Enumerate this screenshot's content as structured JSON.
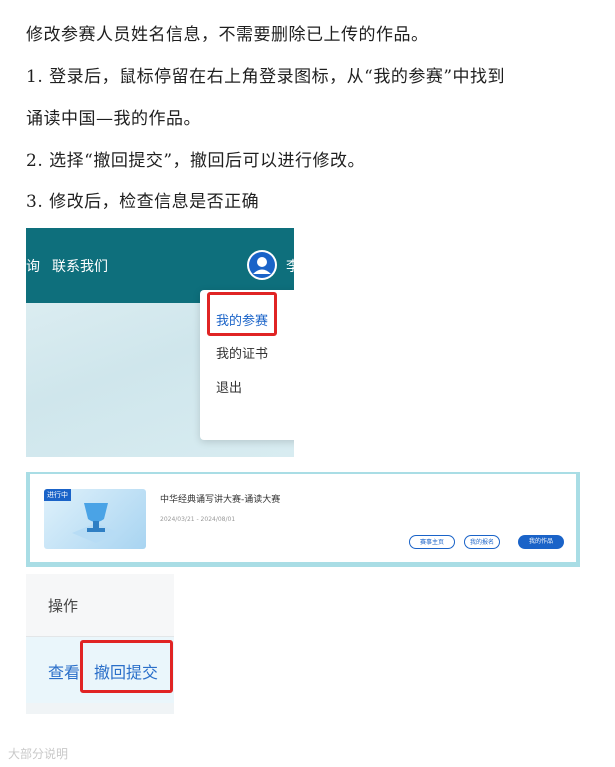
{
  "instructions": {
    "intro": "修改参赛人员姓名信息，不需要删除已上传的作品。",
    "step1_a": "1. 登录后，鼠标停留在右上角登录图标，从“我的参赛”中找到",
    "step1_b": "诵读中国—我的作品。",
    "step2": "2. 选择“撤回提交”，撤回后可以进行修改。",
    "step3": "3. 修改后，检查信息是否正确"
  },
  "screenshot1": {
    "nav_partial": "询",
    "nav_contact": "联系我们",
    "user_partial": "李",
    "menu": [
      "我的参赛",
      "我的证书",
      "退出"
    ]
  },
  "screenshot2": {
    "status_tag": "进行中",
    "title": "中华经典诵写讲大赛-诵读大赛",
    "date": "2024/03/21 - 2024/08/01",
    "buttons": [
      "赛事主页",
      "我的报名",
      "我的作品"
    ]
  },
  "screenshot3": {
    "header": "操作",
    "view": "查看",
    "withdraw": "撤回提交"
  },
  "watermark": "大部分说明"
}
